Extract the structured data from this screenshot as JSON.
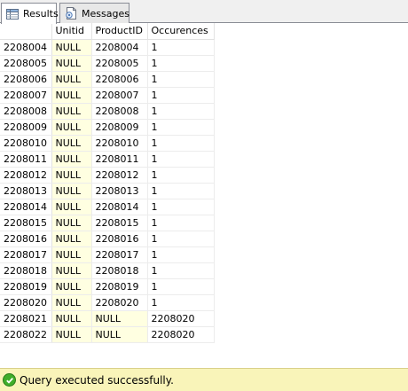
{
  "tabs": [
    {
      "label": "Results",
      "active": true,
      "icon": "grid-icon"
    },
    {
      "label": "Messages",
      "active": false,
      "icon": "messages-icon"
    }
  ],
  "grid": {
    "columns": [
      "",
      "Unitid",
      "ProductID",
      "Occurences"
    ],
    "rows": [
      [
        "2208004",
        "NULL",
        "2208004",
        "1"
      ],
      [
        "2208005",
        "NULL",
        "2208005",
        "1"
      ],
      [
        "2208006",
        "NULL",
        "2208006",
        "1"
      ],
      [
        "2208007",
        "NULL",
        "2208007",
        "1"
      ],
      [
        "2208008",
        "NULL",
        "2208008",
        "1"
      ],
      [
        "2208009",
        "NULL",
        "2208009",
        "1"
      ],
      [
        "2208010",
        "NULL",
        "2208010",
        "1"
      ],
      [
        "2208011",
        "NULL",
        "2208011",
        "1"
      ],
      [
        "2208012",
        "NULL",
        "2208012",
        "1"
      ],
      [
        "2208013",
        "NULL",
        "2208013",
        "1"
      ],
      [
        "2208014",
        "NULL",
        "2208014",
        "1"
      ],
      [
        "2208015",
        "NULL",
        "2208015",
        "1"
      ],
      [
        "2208016",
        "NULL",
        "2208016",
        "1"
      ],
      [
        "2208017",
        "NULL",
        "2208017",
        "1"
      ],
      [
        "2208018",
        "NULL",
        "2208018",
        "1"
      ],
      [
        "2208019",
        "NULL",
        "2208019",
        "1"
      ],
      [
        "2208020",
        "NULL",
        "2208020",
        "1"
      ],
      [
        "2208021",
        "NULL",
        "NULL",
        "2208020"
      ],
      [
        "2208022",
        "NULL",
        "NULL",
        "2208020"
      ]
    ],
    "null_highlight_color": "#ffffe1"
  },
  "status": {
    "text": "Query executed successfully.",
    "icon": "success-check-icon",
    "background": "#f9f4b9"
  }
}
